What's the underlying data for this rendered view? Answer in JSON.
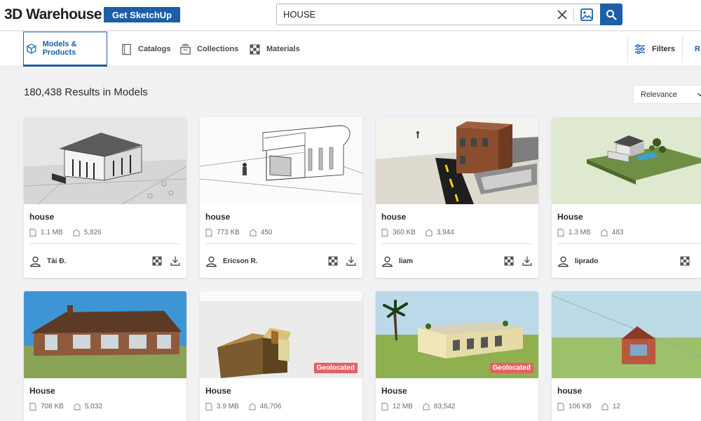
{
  "header": {
    "logo": "3D Warehouse",
    "cta_label": "Get SketchUp",
    "search_value": "HOUSE",
    "icons": {
      "clear": "close-icon",
      "image_search": "image-icon",
      "search": "search-icon"
    }
  },
  "nav": {
    "tabs": [
      {
        "label": "Models & Products",
        "icon": "cube-icon",
        "active": true
      },
      {
        "label": "Catalogs",
        "icon": "catalog-icon",
        "active": false
      },
      {
        "label": "Collections",
        "icon": "collection-icon",
        "active": false
      },
      {
        "label": "Materials",
        "icon": "materials-icon",
        "active": false
      }
    ],
    "filters_label": "Filters",
    "cut_label": "R"
  },
  "results": {
    "count_label": "180,438 Results in Models",
    "sort_label": "Relevance"
  },
  "colors": {
    "brand": "#1c5ea8",
    "geolocated": "#e16262"
  },
  "cards": [
    {
      "title": "house",
      "size": "1.1 MB",
      "downloads": "5,826",
      "user": "Tài Đ.",
      "badge": "",
      "scene": "sketch-villa"
    },
    {
      "title": "house",
      "size": "773 KB",
      "downloads": "450",
      "user": "Ericson R.",
      "badge": "",
      "scene": "line-drawing"
    },
    {
      "title": "house",
      "size": "360 KB",
      "downloads": "3,944",
      "user": "liam",
      "badge": "",
      "scene": "brick-street"
    },
    {
      "title": "House",
      "size": "1.3 MB",
      "downloads": "483",
      "user": "liprado",
      "badge": "",
      "scene": "garden-pool"
    },
    {
      "title": "House",
      "size": "708 KB",
      "downloads": "5,032",
      "user": "",
      "badge": "",
      "scene": "ranch"
    },
    {
      "title": "House",
      "size": "3.9 MB",
      "downloads": "46,706",
      "user": "",
      "badge": "Geolocated",
      "scene": "box-house"
    },
    {
      "title": "House",
      "size": "12 MB",
      "downloads": "83,542",
      "user": "",
      "badge": "Geolocated",
      "scene": "flat-villa"
    },
    {
      "title": "house",
      "size": "106 KB",
      "downloads": "12",
      "user": "",
      "badge": "",
      "scene": "small-brick"
    }
  ]
}
